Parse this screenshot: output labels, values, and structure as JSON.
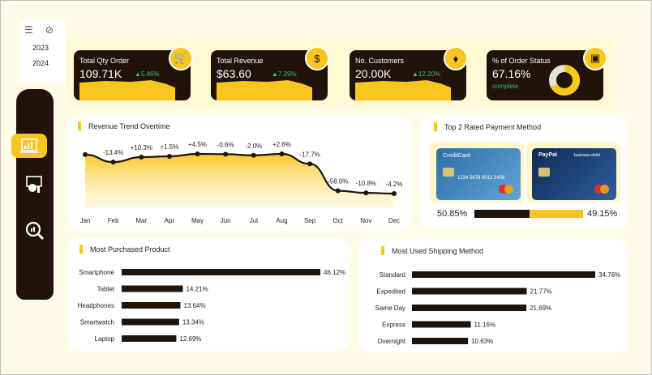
{
  "filters": {
    "years": [
      "2023",
      "2024"
    ]
  },
  "kpis": {
    "total_qty": {
      "title": "Total Qty Order",
      "value": "109.71K",
      "delta": "▲5.46%"
    },
    "total_revenue": {
      "title": "Total Revenue",
      "value": "$63.60",
      "delta": "▲7.29%"
    },
    "customers": {
      "title": "No. Customers",
      "value": "20.00K",
      "delta": "▲12.20%"
    },
    "order_status": {
      "title": "% of Order Status",
      "value": "67.16%",
      "sub": "complete",
      "fraction": 0.6716
    }
  },
  "colors": {
    "accent": "#f9c51f",
    "dark": "#1f130a",
    "panel": "#fff9d6",
    "positive": "#3fbf6a"
  },
  "icons": [
    "checklist-icon",
    "clear-filter-icon",
    "dashboard-icon",
    "analytics-icon",
    "search-icon",
    "cart-icon",
    "money-icon",
    "handshake-icon",
    "box-icon"
  ],
  "payment": {
    "title": "Top 2 Rated Payment Method",
    "left_pct": "50.85%",
    "right_pct": "49.15%",
    "left_share": 50.85,
    "card1": {
      "brand": "CreditCard",
      "number": "1234 5678 9012 3456"
    },
    "card2": {
      "brand": "PayPal",
      "label": "business debit"
    }
  },
  "chart_data": [
    {
      "type": "area",
      "title": "Revenue Trend Overtime",
      "categories": [
        "Jan",
        "Feb",
        "Mar",
        "Apr",
        "May",
        "Jun",
        "Jul",
        "Aug",
        "Sep",
        "Oct",
        "Nov",
        "Dec"
      ],
      "values": [
        100,
        86.6,
        95.5,
        96.9,
        101.3,
        100.7,
        98.7,
        101.3,
        83.4,
        35.0,
        31.2,
        29.9
      ],
      "labels": [
        "",
        "-13.4%",
        "+10.3%",
        "+1.5%",
        "+4.5%",
        "-0.6%",
        "-2.0%",
        "+2.6%",
        "-17.7%",
        "-58.0%",
        "-10.8%",
        "-4.2%"
      ],
      "grid": false
    },
    {
      "type": "bar",
      "title": "Most Purchased Product",
      "orientation": "horizontal",
      "categories": [
        "Smartphone",
        "Tablet",
        "Headphones",
        "Smartwatch",
        "Laptop"
      ],
      "values": [
        46.12,
        14.21,
        13.64,
        13.34,
        12.69
      ],
      "value_labels": [
        "46.12%",
        "14.21%",
        "13.64%",
        "13.34%",
        "12.69%"
      ]
    },
    {
      "type": "bar",
      "title": "Most Used Shipping Method",
      "orientation": "horizontal",
      "categories": [
        "Standard",
        "Expedited",
        "Same Day",
        "Express",
        "Overnight"
      ],
      "values": [
        34.76,
        21.77,
        21.69,
        11.16,
        10.63
      ],
      "value_labels": [
        "34.76%",
        "21.77%",
        "21.69%",
        "11.16%",
        "10.63%"
      ]
    }
  ]
}
